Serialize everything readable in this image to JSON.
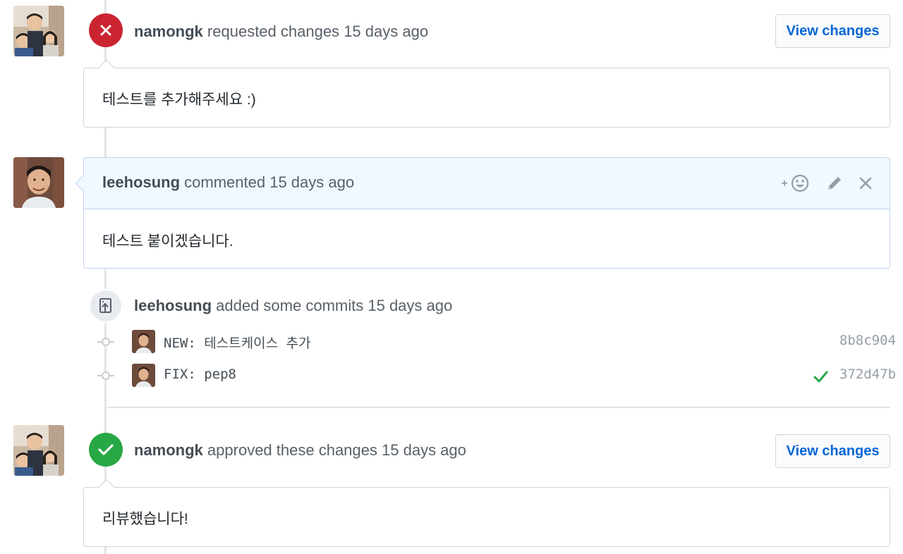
{
  "review_1": {
    "author": "namongk",
    "action": "requested changes",
    "time": "15 days ago",
    "button": "View changes",
    "body": "테스트를 추가해주세요 :)",
    "status_color": "#cb2431",
    "icon": "x-icon"
  },
  "comment_1": {
    "author": "leehosung",
    "action": "commented",
    "time": "15 days ago",
    "body": "테스트 붙이겠습니다.",
    "reaction_icon": "add-reaction-icon",
    "edit_icon": "pencil-icon",
    "delete_icon": "close-icon"
  },
  "commits_event": {
    "author": "leehosung",
    "action": "added some commits",
    "time": "15 days ago",
    "icon": "repo-push-icon",
    "commits": [
      {
        "message": "NEW: 테스트케이스 추가",
        "sha": "8b8c904",
        "verified": false
      },
      {
        "message": "FIX: pep8",
        "sha": "372d47b",
        "verified": true
      }
    ]
  },
  "review_2": {
    "author": "namongk",
    "action": "approved these changes",
    "time": "15 days ago",
    "button": "View changes",
    "body": "리뷰했습니다!",
    "status_color": "#28a745",
    "icon": "check-icon"
  }
}
